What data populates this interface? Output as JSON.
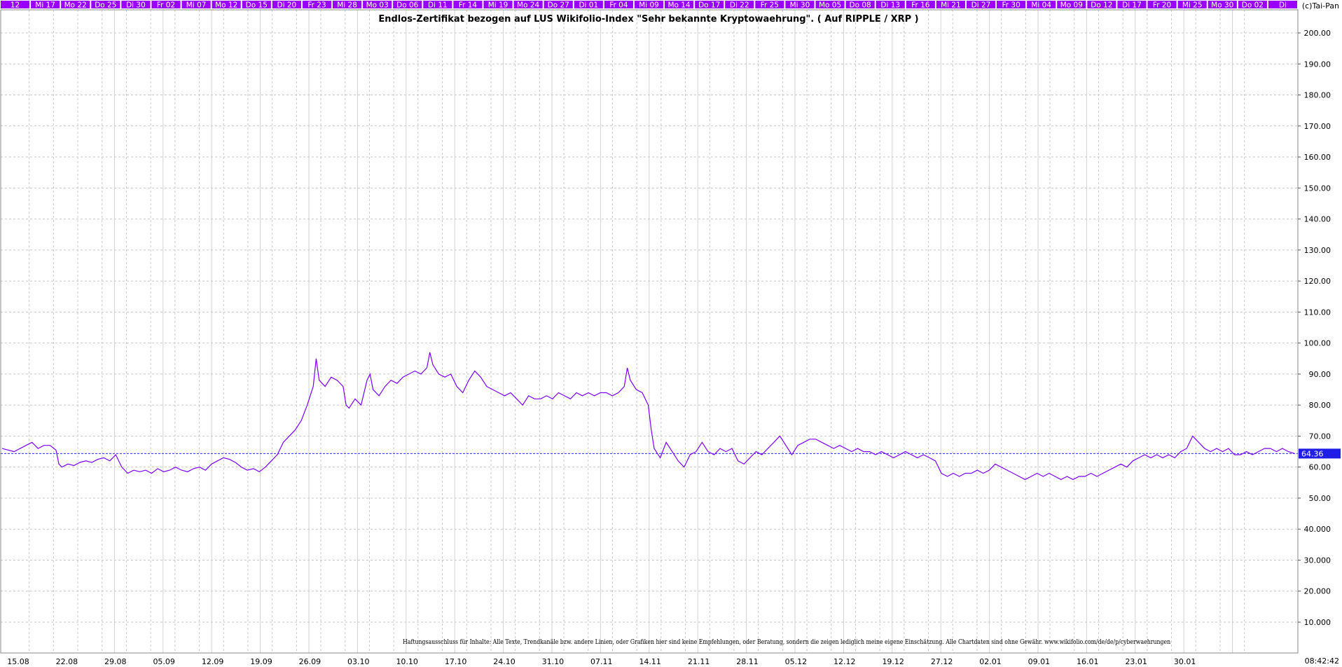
{
  "title": "Endlos-Zertifikat bezogen auf LUS Wikifolio-Index \"Sehr bekannte Kryptowaehrung\". ( Auf RIPPLE / XRP )",
  "copyright": "(c)Tai-Pan",
  "disclaimer": "Haftungsausschluss für Inhalte: Alle Texte, Trendkanäle bzw. andere Linien, oder Grafiken hier sind keine Empfehlungen, oder Beratung, sondern die zeigen lediglich meine eigene Einschätzung. Alle Chartdaten sind ohne Gewähr.  www.wikifolio.com/de/de/p/cyberwaehrungen",
  "bottom_right_label": "08:42:42",
  "top_day_labels": [
    "12",
    "Mi 17",
    "Mo 22",
    "Do 25",
    "Di 30",
    "Fr 02",
    "Mi 07",
    "Mo 12",
    "Do 15",
    "Di 20",
    "Fr 23",
    "Mi 28",
    "Mo 03",
    "Do 06",
    "Di 11",
    "Fr 14",
    "Mi 19",
    "Mo 24",
    "Do 27",
    "Di 01",
    "Fr 04",
    "Mi 09",
    "Mo 14",
    "Do 17",
    "Di 22",
    "Fr 25",
    "Mi 30",
    "Mo 05",
    "Do 08",
    "Di 13",
    "Fr 16",
    "Mi 21",
    "Di 27",
    "Fr 30",
    "Mi 04",
    "Mo 09",
    "Do 12",
    "Di 17",
    "Fr 20",
    "Mi 25",
    "Mo 30",
    "Do 02",
    "Di"
  ],
  "colors": {
    "line": "#7a00ff",
    "ref_line": "#2323ff",
    "price_tag": "#1e1ee6",
    "top_label_bg": "#9900ff",
    "grid": "#c8c8c8"
  },
  "chart_data": {
    "type": "line",
    "title": "Endlos-Zertifikat bezogen auf LUS Wikifolio-Index \"Sehr bekannte Kryptowaehrung\". ( Auf RIPPLE / XRP )",
    "xlabel": "",
    "ylabel": "",
    "x_tick_labels": [
      "15.08",
      "22.08",
      "29.08",
      "05.09",
      "12.09",
      "19.09",
      "26.09",
      "03.10",
      "10.10",
      "17.10",
      "24.10",
      "31.10",
      "07.11",
      "14.11",
      "21.11",
      "28.11",
      "05.12",
      "12.12",
      "19.12",
      "27.12",
      "02.01",
      "09.01",
      "16.01",
      "23.01",
      "30.01"
    ],
    "y_ticks": [
      10,
      20,
      30,
      40,
      50,
      60,
      70,
      80,
      90,
      100,
      110,
      120,
      130,
      140,
      150,
      160,
      170,
      180,
      190,
      200
    ],
    "y_tick_labels": [
      "10.000",
      "20.000",
      "30.000",
      "40.000",
      "50.00",
      "60.00",
      "70.00",
      "80.00",
      "90.00",
      "100.00",
      "110.00",
      "120.00",
      "130.00",
      "140.00",
      "150.00",
      "160.00",
      "170.00",
      "180.00",
      "190.00",
      "200.00"
    ],
    "ylim": [
      0,
      210
    ],
    "grid": true,
    "last_value": 64.36,
    "last_value_label": "64.36",
    "series": [
      {
        "values": [
          [
            0,
            66
          ],
          [
            2,
            65
          ],
          [
            4,
            67
          ],
          [
            5,
            68
          ],
          [
            6,
            66
          ],
          [
            7,
            67
          ],
          [
            8,
            67
          ],
          [
            9,
            65.5
          ],
          [
            9.5,
            61
          ],
          [
            10,
            60
          ],
          [
            11,
            61
          ],
          [
            12,
            60.5
          ],
          [
            13,
            61.5
          ],
          [
            14,
            62
          ],
          [
            15,
            61.5
          ],
          [
            16,
            62.5
          ],
          [
            17,
            63
          ],
          [
            18,
            62
          ],
          [
            19,
            64
          ],
          [
            20,
            60
          ],
          [
            21,
            58
          ],
          [
            22,
            59
          ],
          [
            23,
            58.5
          ],
          [
            24,
            59
          ],
          [
            25,
            58
          ],
          [
            26,
            59.5
          ],
          [
            27,
            58.5
          ],
          [
            28,
            59
          ],
          [
            29,
            60
          ],
          [
            30,
            59
          ],
          [
            31,
            58.5
          ],
          [
            32,
            59.5
          ],
          [
            33,
            60
          ],
          [
            34,
            59
          ],
          [
            35,
            61
          ],
          [
            36,
            62
          ],
          [
            37,
            63
          ],
          [
            38,
            62.5
          ],
          [
            39,
            61.5
          ],
          [
            40,
            60
          ],
          [
            41,
            59
          ],
          [
            42,
            59.5
          ],
          [
            43,
            58.5
          ],
          [
            44,
            60
          ],
          [
            45,
            62
          ],
          [
            46,
            64
          ],
          [
            47,
            68
          ],
          [
            48,
            70
          ],
          [
            49,
            72
          ],
          [
            50,
            75
          ],
          [
            51,
            80
          ],
          [
            52,
            86
          ],
          [
            52.5,
            95
          ],
          [
            53,
            88
          ],
          [
            54,
            86
          ],
          [
            55,
            89
          ],
          [
            56,
            88
          ],
          [
            57,
            86
          ],
          [
            57.5,
            80
          ],
          [
            58,
            79
          ],
          [
            59,
            82
          ],
          [
            60,
            80
          ],
          [
            61,
            88
          ],
          [
            61.5,
            90
          ],
          [
            62,
            85
          ],
          [
            63,
            83
          ],
          [
            64,
            86
          ],
          [
            65,
            88
          ],
          [
            66,
            87
          ],
          [
            67,
            89
          ],
          [
            68,
            90
          ],
          [
            69,
            91
          ],
          [
            70,
            90
          ],
          [
            71,
            92
          ],
          [
            71.5,
            97
          ],
          [
            72,
            93
          ],
          [
            73,
            90
          ],
          [
            74,
            89
          ],
          [
            75,
            90
          ],
          [
            76,
            86
          ],
          [
            77,
            84
          ],
          [
            78,
            88
          ],
          [
            79,
            91
          ],
          [
            80,
            89
          ],
          [
            81,
            86
          ],
          [
            82,
            85
          ],
          [
            83,
            84
          ],
          [
            84,
            83
          ],
          [
            85,
            84
          ],
          [
            86,
            82
          ],
          [
            87,
            80
          ],
          [
            88,
            83
          ],
          [
            89,
            82
          ],
          [
            90,
            82
          ],
          [
            91,
            83
          ],
          [
            92,
            82
          ],
          [
            93,
            84
          ],
          [
            94,
            83
          ],
          [
            95,
            82
          ],
          [
            96,
            84
          ],
          [
            97,
            83
          ],
          [
            98,
            84
          ],
          [
            99,
            83
          ],
          [
            100,
            84
          ],
          [
            101,
            84
          ],
          [
            102,
            83
          ],
          [
            103,
            84
          ],
          [
            104,
            86
          ],
          [
            104.5,
            92
          ],
          [
            105,
            88
          ],
          [
            106,
            85
          ],
          [
            107,
            84
          ],
          [
            108,
            80
          ],
          [
            108.5,
            72
          ],
          [
            109,
            66
          ],
          [
            110,
            63
          ],
          [
            111,
            68
          ],
          [
            112,
            65
          ],
          [
            113,
            62
          ],
          [
            114,
            60
          ],
          [
            115,
            64
          ],
          [
            116,
            65
          ],
          [
            117,
            68
          ],
          [
            118,
            65
          ],
          [
            119,
            64
          ],
          [
            120,
            66
          ],
          [
            121,
            65
          ],
          [
            122,
            66
          ],
          [
            123,
            62
          ],
          [
            124,
            61
          ],
          [
            125,
            63
          ],
          [
            126,
            65
          ],
          [
            127,
            64
          ],
          [
            128,
            66
          ],
          [
            129,
            68
          ],
          [
            130,
            70
          ],
          [
            131,
            67
          ],
          [
            132,
            64
          ],
          [
            133,
            67
          ],
          [
            134,
            68
          ],
          [
            135,
            69
          ],
          [
            136,
            69
          ],
          [
            137,
            68
          ],
          [
            138,
            67
          ],
          [
            139,
            66
          ],
          [
            140,
            67
          ],
          [
            141,
            66
          ],
          [
            142,
            65
          ],
          [
            143,
            66
          ],
          [
            144,
            65
          ],
          [
            145,
            65
          ],
          [
            146,
            64
          ],
          [
            147,
            65
          ],
          [
            148,
            64
          ],
          [
            149,
            63
          ],
          [
            150,
            64
          ],
          [
            151,
            65
          ],
          [
            152,
            64
          ],
          [
            153,
            63
          ],
          [
            154,
            64
          ],
          [
            155,
            63
          ],
          [
            156,
            62
          ],
          [
            157,
            58
          ],
          [
            158,
            57
          ],
          [
            159,
            58
          ],
          [
            160,
            57
          ],
          [
            161,
            58
          ],
          [
            162,
            58
          ],
          [
            163,
            59
          ],
          [
            164,
            58
          ],
          [
            165,
            59
          ],
          [
            166,
            61
          ],
          [
            167,
            60
          ],
          [
            168,
            59
          ],
          [
            169,
            58
          ],
          [
            170,
            57
          ],
          [
            171,
            56
          ],
          [
            172,
            57
          ],
          [
            173,
            58
          ],
          [
            174,
            57
          ],
          [
            175,
            58
          ],
          [
            176,
            57
          ],
          [
            177,
            56
          ],
          [
            178,
            57
          ],
          [
            179,
            56
          ],
          [
            180,
            57
          ],
          [
            181,
            57
          ],
          [
            182,
            58
          ],
          [
            183,
            57
          ],
          [
            184,
            58
          ],
          [
            185,
            59
          ],
          [
            186,
            60
          ],
          [
            187,
            61
          ],
          [
            188,
            60
          ],
          [
            189,
            62
          ],
          [
            190,
            63
          ],
          [
            191,
            64
          ],
          [
            192,
            63
          ],
          [
            193,
            64
          ],
          [
            194,
            63
          ],
          [
            195,
            64
          ],
          [
            196,
            63
          ],
          [
            197,
            65
          ],
          [
            198,
            66
          ],
          [
            199,
            70
          ],
          [
            200,
            68
          ],
          [
            201,
            66
          ],
          [
            202,
            65
          ],
          [
            203,
            66
          ],
          [
            204,
            65
          ],
          [
            205,
            66
          ],
          [
            206,
            64
          ],
          [
            207,
            64
          ],
          [
            208,
            65
          ],
          [
            209,
            64
          ],
          [
            210,
            65
          ],
          [
            211,
            66
          ],
          [
            212,
            66
          ],
          [
            213,
            65
          ],
          [
            214,
            66
          ],
          [
            215,
            65
          ],
          [
            216,
            64.4
          ]
        ]
      }
    ]
  }
}
